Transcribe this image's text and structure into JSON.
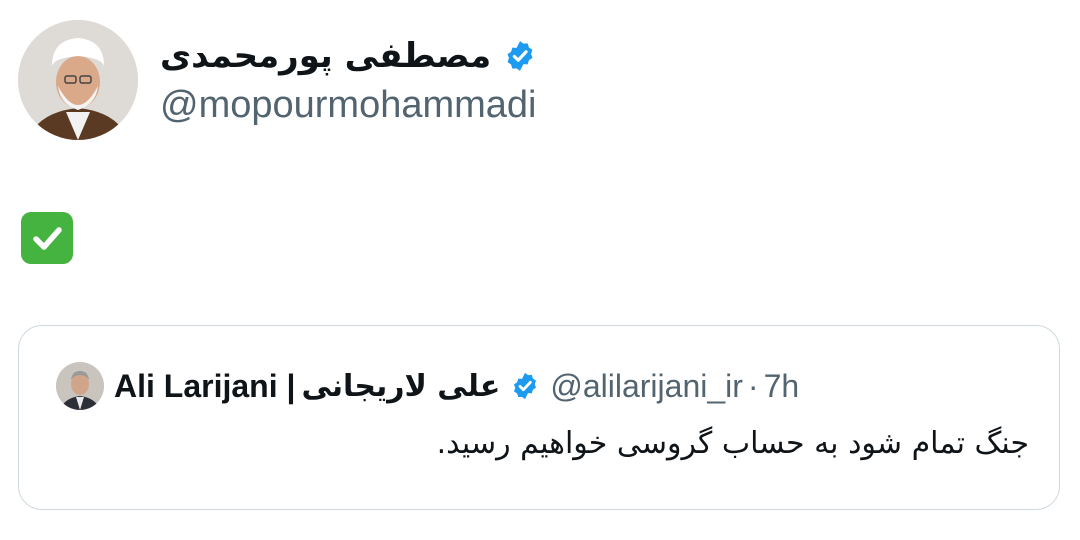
{
  "tweet": {
    "author": {
      "display_name": "مصطفی پورمحمدی",
      "handle": "@mopourmohammadi",
      "verified_icon": "verified-badge-icon",
      "avatar_icon": "avatar"
    },
    "body_emoji": "white-heavy-check-mark-icon",
    "colors": {
      "verified": "#1d9bf0",
      "check": "#44b33f",
      "handle": "#536471",
      "border": "#cfd9de"
    }
  },
  "quote": {
    "author": {
      "name": "Ali Larijani |",
      "name_fa": "علی لاریجانی",
      "handle": "@alilarijani_ir",
      "separator": "·",
      "time": "7h"
    },
    "text": "جنگ تمام شود به حساب گروسی خواهیم رسید."
  }
}
